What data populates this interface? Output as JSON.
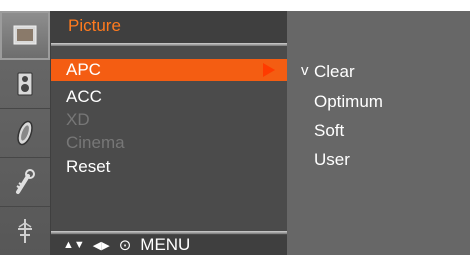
{
  "menu": {
    "title": "Picture",
    "items": [
      {
        "label": "APC",
        "state": "selected",
        "has_submenu": true
      },
      {
        "label": "ACC",
        "state": "normal"
      },
      {
        "label": "XD",
        "state": "disabled"
      },
      {
        "label": "Cinema",
        "state": "disabled"
      },
      {
        "label": "Reset",
        "state": "normal"
      }
    ]
  },
  "submenu": {
    "items": [
      {
        "label": "Clear",
        "check": "v"
      },
      {
        "label": "Optimum",
        "check": ""
      },
      {
        "label": "Soft",
        "check": ""
      },
      {
        "label": "User",
        "check": ""
      }
    ]
  },
  "footer": {
    "nav_updown": "▲▼",
    "nav_leftright": "◀▶",
    "ok_symbol": "⊙",
    "menu_label": "MENU"
  },
  "sidebar_icons": [
    "picture-icon",
    "speaker-icon",
    "clock-icon",
    "key-icon",
    "antenna-icon"
  ],
  "colors": {
    "accent": "#f45d12",
    "title": "#ff7a1e",
    "panel": "#4b4b4b",
    "subpanel": "#676767"
  }
}
